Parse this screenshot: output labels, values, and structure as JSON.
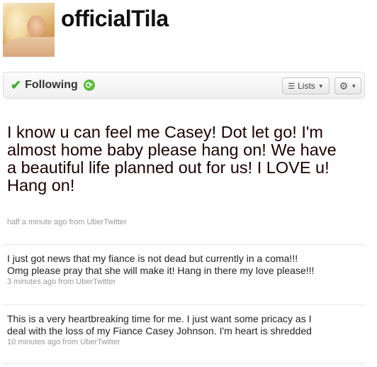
{
  "profile": {
    "screen_name": "officialTila",
    "avatar_icon": "profile-photo"
  },
  "follow_bar": {
    "following_label": "Following",
    "lists_label": "Lists",
    "check_color": "#3fae2a",
    "refresh_color": "#5bbb3b"
  },
  "featured_tweet": {
    "text": "I know u can feel me Casey! Dot let go! I'm almost home baby please hang on! We have a beautiful life planned out for us! I LOVE u! Hang on!",
    "meta": "half a minute ago from UberTwitter"
  },
  "tweets": [
    {
      "text": "I just got news that my fiance is not dead but currently in a coma!!! Omg please pray that she will make it! Hang in there my love please!!!",
      "meta": "3 minutes ago from UberTwitter"
    },
    {
      "text": "This is a very heartbreaking time for me. I just want some pricacy as I deal with the loss of my Fiance Casey Johnson. I'm heart is shredded",
      "meta": "10 minutes ago from UberTwitter"
    }
  ]
}
